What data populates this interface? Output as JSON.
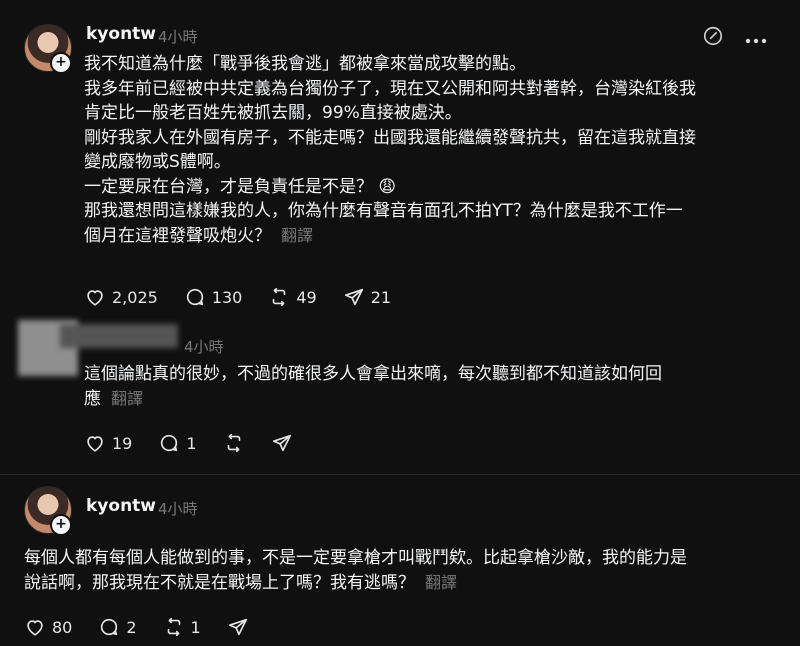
{
  "post1": {
    "username": "kyontw",
    "time": "4小時",
    "lines": [
      "我不知道為什麼「戰爭後我會逃」都被拿來當成攻擊的點。",
      "我多年前已經被中共定義為台獨份子了，現在又公開和阿共對著幹，台灣染紅後我",
      "肯定比一般老百姓先被抓去關，99%直接被處決。",
      "剛好我家人在外國有房子，不能走嗎？出國我還能繼續發聲抗共，留在這我就直接",
      "變成廢物或S體啊。",
      "一定要尿在台灣，才是負責任是不是？ 😩",
      "那我還想問這樣嫌我的人，你為什麼有聲音有面孔不拍YT？為什麼是我不工作一",
      "個月在這裡發聲吸炮火？"
    ],
    "translate": "翻譯",
    "likes": "2,025",
    "comments": "130",
    "reposts": "49",
    "shares": "21"
  },
  "reply": {
    "time": "4小時",
    "lines": [
      "這個論點真的很妙，不過的確很多人會拿出來嘀，每次聽到都不知道該如何回",
      "應"
    ],
    "translate": "翻譯",
    "likes": "19",
    "comments": "1"
  },
  "post2": {
    "username": "kyontw",
    "time": "4小時",
    "lines": [
      "每個人都有每個人能做到的事，不是一定要拿槍才叫戰鬥欸。比起拿槍沙敵，我的能力是",
      "說話啊，那我現在不就是在戰場上了嗎？我有逃嗎？"
    ],
    "translate": "翻譯",
    "likes": "80",
    "comments": "2",
    "reposts": "1"
  },
  "icons": {
    "like": "heart-icon",
    "comment": "comment-icon",
    "repost": "repost-icon",
    "share": "send-icon",
    "edit": "edit-icon",
    "more": "more-icon"
  }
}
